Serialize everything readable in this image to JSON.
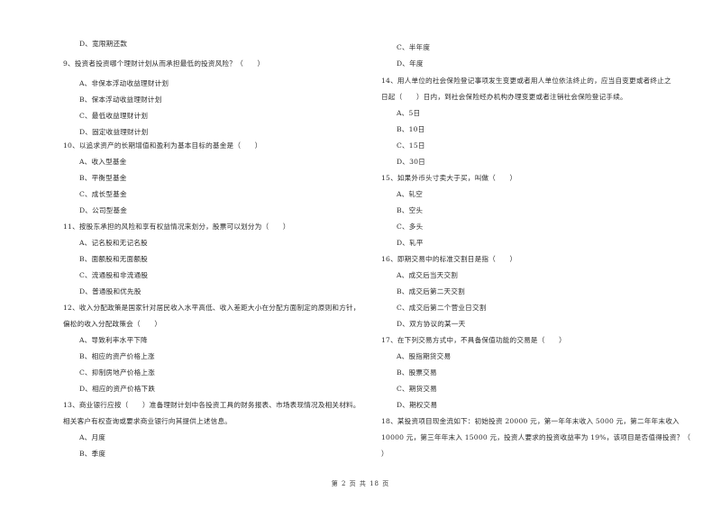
{
  "left_column": {
    "q8_tail": {
      "option_d": "D、宽限期还款"
    },
    "q9": {
      "stem": "9、投资者投资哪个理财计划从而承担最低的投资风险？（　　）",
      "options": [
        "A、非保本浮动收益理财计划",
        "B、保本浮动收益理财计划",
        "C、最低收益理财计划",
        "D、固定收益理财计划"
      ]
    },
    "q10": {
      "stem": "10、以追求资产的长期增值和盈利为基本目标的基金是（　　）",
      "options": [
        "A、收入型基金",
        "B、平衡型基金",
        "C、成长型基金",
        "D、公司型基金"
      ]
    },
    "q11": {
      "stem": "11、按股东承担的风险和享有权益情况来划分，股票可以划分为（　　）",
      "options": [
        "A、记名股和无记名股",
        "B、面额股和无面额股",
        "C、流通股和非流通股",
        "D、普通股和优先股"
      ]
    },
    "q12": {
      "stem_line1": "12、收入分配政策是国家针对居民收入水平高低、收入差距大小在分配方面制定的原则和方针，",
      "stem_line2": "偏松的收入分配政策会（　　）",
      "options": [
        "A、导致利率水平下降",
        "B、相应的资产价格上涨",
        "C、抑制房地产价格上涨",
        "D、相应的资产价格下跌"
      ]
    },
    "q13": {
      "stem_line1": "13、商业银行应按（　　）准备理财计划中各投资工具的财务报表、市场表现情况及相关材料。",
      "stem_line2": "相关客户有权查询或要求商业银行向其提供上述信息。",
      "options": [
        "A、月度",
        "B、季度"
      ]
    }
  },
  "right_column": {
    "q13_tail": {
      "options": [
        "C、半年度",
        "D、年度"
      ]
    },
    "q14": {
      "stem_line1": "14、用人单位的社会保险登记事项发生变更或者用人单位依法终止的，应当自变更或者终止之",
      "stem_line2": "日起（　　）日内，到社会保险经办机构办理变更或者注销社会保险登记手续。",
      "options": [
        "A、5日",
        "B、10日",
        "C、15日",
        "D、30日"
      ]
    },
    "q15": {
      "stem": "15、如果外币头寸卖大于买，叫做（　　）",
      "options": [
        "A、轧空",
        "B、空头",
        "C、多头",
        "D、轧平"
      ]
    },
    "q16": {
      "stem": "16、即期交易中的标准交割日是指（　　）",
      "options": [
        "A、成交后当天交割",
        "B、成交后第二天交割",
        "C、成交后第二个营业日交割",
        "D、双方协议的某一天"
      ]
    },
    "q17": {
      "stem": "17、在下列交易方式中，不具备保值功能的交易是（　　）",
      "options": [
        "A、股指期货交易",
        "B、股票交易",
        "C、期货交易",
        "D、期权交易"
      ]
    },
    "q18": {
      "stem_line1": "18、某投资项目现金流如下：初始投资 20000 元，第一年年末收入 5000 元，第二年年末收入",
      "stem_line2": "10000 元，第三年年末入 15000 元，投资人要求的投资收益率为 19%，该项目是否值得投资？（",
      "stem_line3": "）"
    }
  },
  "footer": {
    "page_label": "第 2 页 共 18 页"
  }
}
